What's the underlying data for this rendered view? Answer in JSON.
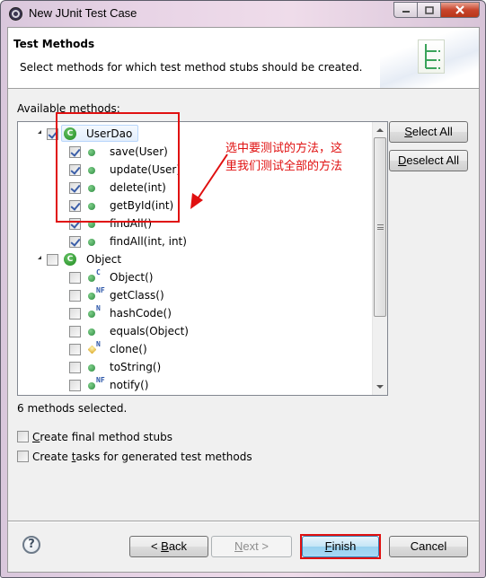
{
  "window": {
    "title": "New JUnit Test Case",
    "controls": [
      "minimize",
      "maximize",
      "close"
    ]
  },
  "header": {
    "title": "Test Methods",
    "description": "Select methods for which test method stubs should be created."
  },
  "available_methods_label": {
    "pre": "Available ",
    "accel": "m",
    "post": "ethods:"
  },
  "tree": {
    "classes": [
      {
        "name": "UserDao",
        "icon": "class-icon",
        "checked": true,
        "expanded": true,
        "selected": true,
        "methods": [
          {
            "label": "save(User)",
            "checked": true,
            "icon": "public-method-icon",
            "badge": ""
          },
          {
            "label": "update(User)",
            "checked": true,
            "icon": "public-method-icon",
            "badge": ""
          },
          {
            "label": "delete(int)",
            "checked": true,
            "icon": "public-method-icon",
            "badge": ""
          },
          {
            "label": "getById(int)",
            "checked": true,
            "icon": "public-method-icon",
            "badge": ""
          },
          {
            "label": "findAll()",
            "checked": true,
            "icon": "public-method-icon",
            "badge": ""
          },
          {
            "label": "findAll(int, int)",
            "checked": true,
            "icon": "public-method-icon",
            "badge": ""
          }
        ]
      },
      {
        "name": "Object",
        "icon": "class-icon",
        "checked": false,
        "expanded": true,
        "selected": false,
        "methods": [
          {
            "label": "Object()",
            "checked": false,
            "icon": "public-method-icon",
            "badge": "C"
          },
          {
            "label": "getClass()",
            "checked": false,
            "icon": "public-method-icon",
            "badge": "NF"
          },
          {
            "label": "hashCode()",
            "checked": false,
            "icon": "public-method-icon",
            "badge": "N"
          },
          {
            "label": "equals(Object)",
            "checked": false,
            "icon": "public-method-icon",
            "badge": ""
          },
          {
            "label": "clone()",
            "checked": false,
            "icon": "protected-method-icon",
            "badge": "N"
          },
          {
            "label": "toString()",
            "checked": false,
            "icon": "public-method-icon",
            "badge": ""
          },
          {
            "label": "notify()",
            "checked": false,
            "icon": "public-method-icon",
            "badge": "NF"
          }
        ]
      }
    ]
  },
  "side_buttons": {
    "select_all": {
      "accel": "S",
      "rest": "elect All"
    },
    "deselect_all": {
      "accel": "D",
      "rest": "eselect All"
    }
  },
  "annotation": {
    "line1": "选中要测试的方法，这",
    "line2": "里我们测试全部的方法",
    "color": "#e01010"
  },
  "status": {
    "selected_count_text": "6 methods selected."
  },
  "options": [
    {
      "pre": "",
      "accel": "C",
      "post": "reate final method stubs",
      "checked": false
    },
    {
      "pre": "Create ",
      "accel": "t",
      "post": "asks for generated test methods",
      "checked": false
    }
  ],
  "footer": {
    "help_glyph": "?",
    "back": {
      "pre": "< ",
      "accel": "B",
      "post": "ack",
      "enabled": true
    },
    "next": {
      "pre": "",
      "accel": "N",
      "post": "ext >",
      "enabled": false
    },
    "finish": {
      "pre": "",
      "accel": "F",
      "post": "inish",
      "enabled": true,
      "default": true
    },
    "cancel": {
      "label": "Cancel",
      "enabled": true
    }
  }
}
